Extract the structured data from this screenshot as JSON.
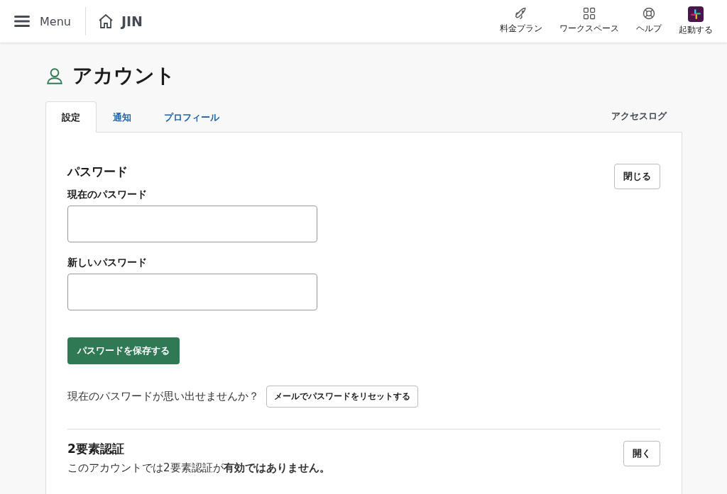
{
  "header": {
    "menu_label": "Menu",
    "workspace": "JIN",
    "nav": [
      {
        "kind": "rocket",
        "label": "料金プラン"
      },
      {
        "kind": "grid",
        "label": "ワークスペース"
      },
      {
        "kind": "help",
        "label": "ヘルプ"
      },
      {
        "kind": "app",
        "label": "起動する"
      }
    ]
  },
  "page_title": "アカウント",
  "tabs": [
    {
      "label": "設定",
      "selected": true
    },
    {
      "label": "通知",
      "selected": false
    },
    {
      "label": "プロフィール",
      "selected": false
    }
  ],
  "access_log": "アクセスログ",
  "password": {
    "title": "パスワード",
    "close_button": "閉じる",
    "fields": [
      {
        "label": "現在のパスワード"
      },
      {
        "label": "新しいパスワード"
      }
    ],
    "save_button": "パスワードを保存する",
    "forgot_text": "現在のパスワードが思い出せませんか？",
    "reset_button": "メールでパスワードをリセットする"
  },
  "two_factor": {
    "title": "2要素認証",
    "open_button": "開く",
    "status_text": "このアカウントでは2要素認証が**有効ではありません。**"
  }
}
